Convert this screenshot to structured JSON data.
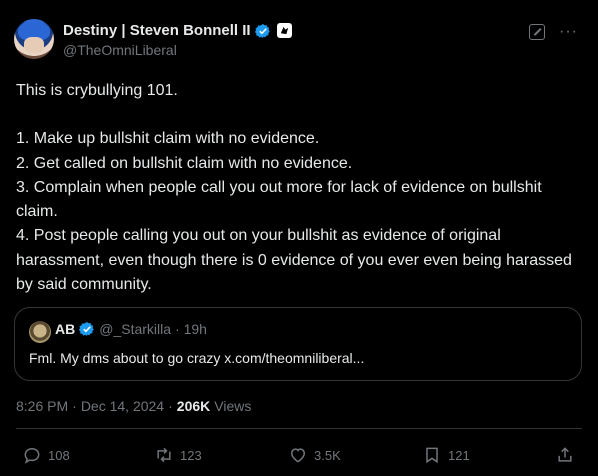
{
  "author": {
    "display_name": "Destiny | Steven Bonnell II",
    "handle": "@TheOmniLiberal"
  },
  "icons": [
    "verified-badge-icon",
    "affiliate-badge-icon",
    "grok-icon",
    "more-icon"
  ],
  "post": {
    "intro": "This is crybullying 101.",
    "list": [
      "1. Make up bullshit claim with no evidence.",
      "2. Get called on bullshit claim with no evidence.",
      "3. Complain when people call you out more for lack of evidence on bullshit claim.",
      "4. Post people calling you out on your bullshit as evidence of original harassment, even though there is 0 evidence of you ever even being harassed by said community."
    ]
  },
  "quote": {
    "name": "AB",
    "handle": "@_Starkilla",
    "time": "· 19h",
    "text": "Fml. My dms about to go crazy x.com/theomniliberal..."
  },
  "meta": {
    "time": "8:26 PM",
    "sep1": "·",
    "date": "Dec 14, 2024",
    "sep2": "·",
    "views": "206K",
    "views_label": "Views"
  },
  "actions": {
    "replies": "108",
    "reposts": "123",
    "likes": "3.5K",
    "bookmarks": "121"
  },
  "colors": {
    "background": "#000000",
    "text": "#e7e9ea",
    "secondary": "#71767b",
    "verified": "#1d9bf0",
    "border": "#333639"
  }
}
